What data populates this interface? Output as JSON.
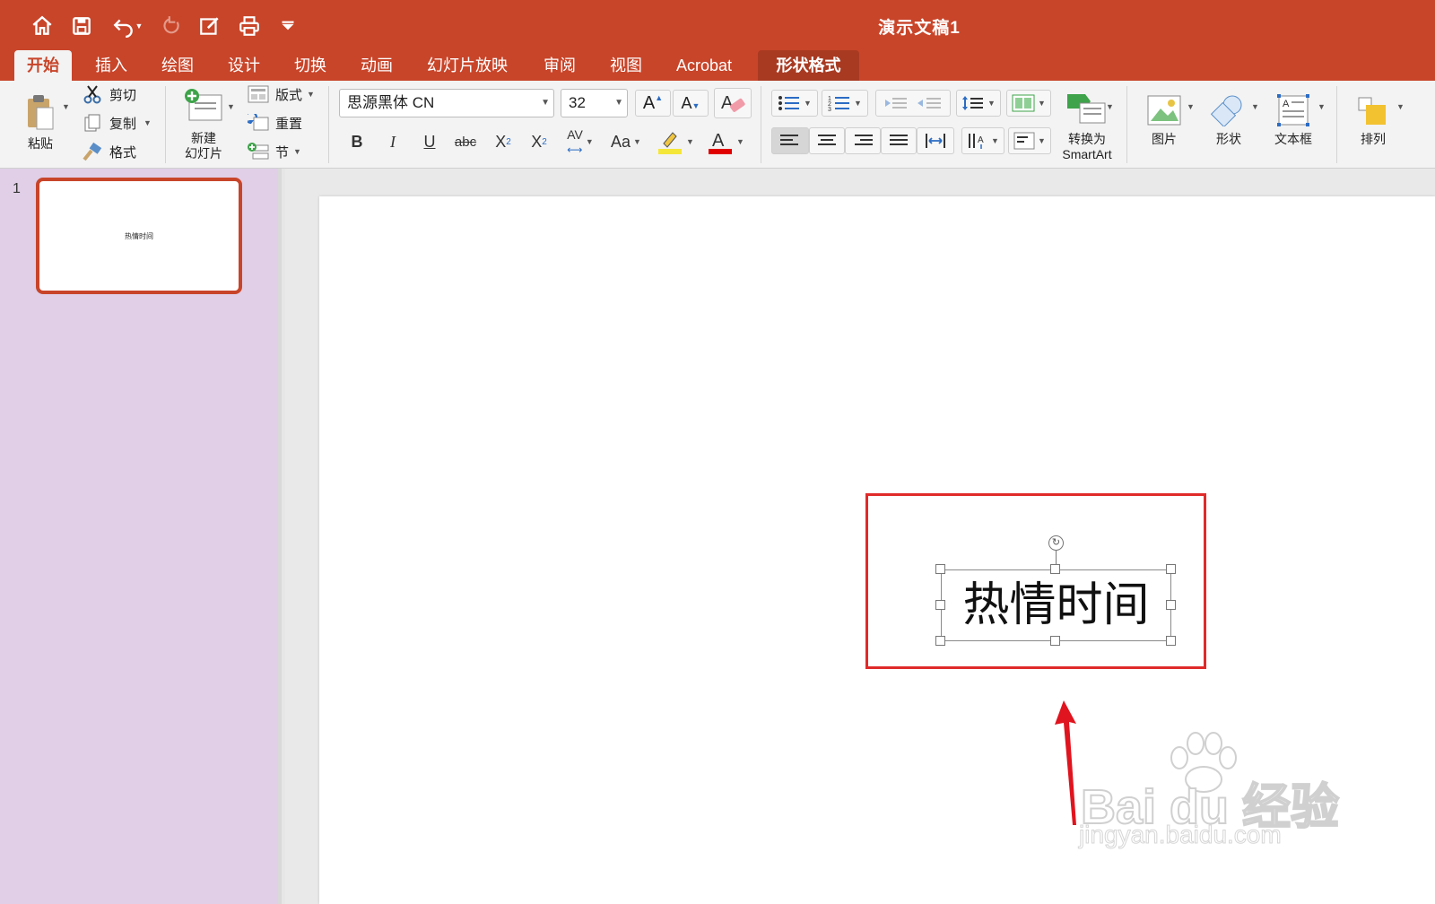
{
  "window": {
    "title": "演示文稿1",
    "accent_color": "#c8452a"
  },
  "quick_access": [
    "home-icon",
    "save-icon",
    "undo-icon",
    "redo-icon",
    "edit-icon",
    "print-icon",
    "customize-icon"
  ],
  "tabs": [
    {
      "label": "开始",
      "active": true
    },
    {
      "label": "插入"
    },
    {
      "label": "绘图"
    },
    {
      "label": "设计"
    },
    {
      "label": "切换"
    },
    {
      "label": "动画"
    },
    {
      "label": "幻灯片放映"
    },
    {
      "label": "审阅"
    },
    {
      "label": "视图"
    },
    {
      "label": "Acrobat"
    },
    {
      "label": "形状格式",
      "contextual": true
    }
  ],
  "ribbon": {
    "paste": "粘贴",
    "cut": "剪切",
    "copy": "复制",
    "format_painter": "格式",
    "new_slide_line1": "新建",
    "new_slide_line2": "幻灯片",
    "layout": "版式",
    "reset": "重置",
    "section": "节",
    "font_name": "思源黑体 CN",
    "font_size": "32",
    "convert_line1": "转换为",
    "convert_line2": "SmartArt",
    "picture": "图片",
    "shape": "形状",
    "textbox": "文本框",
    "arrange": "排列"
  },
  "thumbnails": [
    {
      "number": "1",
      "text": "热情时间",
      "selected": true
    }
  ],
  "slide": {
    "text": "热情时间"
  },
  "watermark": {
    "brand": "Bai du 经验",
    "url": "jingyan.baidu.com"
  }
}
